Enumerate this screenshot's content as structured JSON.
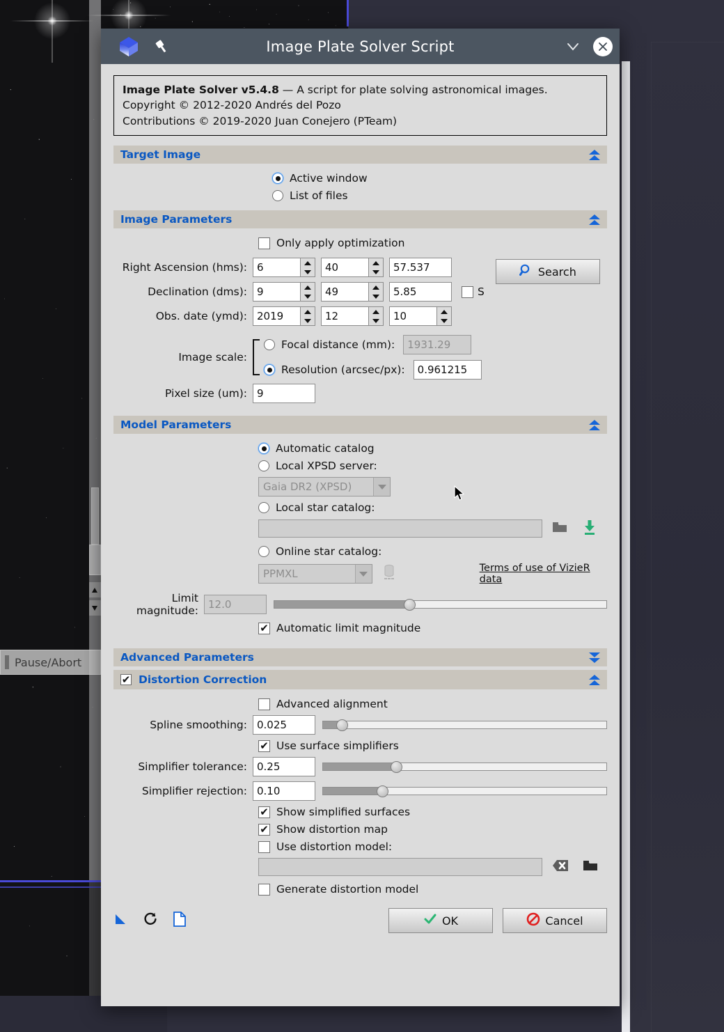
{
  "window": {
    "title": "Image Plate Solver Script",
    "icons": {
      "cube": "cube-icon",
      "pin": "pin-icon",
      "chevron": "chevron-down-icon",
      "close": "close-icon"
    }
  },
  "info": {
    "line1_bold": "Image Plate Solver v5.4.8",
    "line1_rest": " — A script for plate solving astronomical images.",
    "line2": "Copyright © 2012-2020 Andrés del Pozo",
    "line3": "Contributions © 2019-2020 Juan Conejero (PTeam)"
  },
  "sections": {
    "target_image": {
      "title": "Target Image",
      "options": [
        {
          "label": "Active window",
          "selected": true
        },
        {
          "label": "List of files",
          "selected": false
        }
      ]
    },
    "image_parameters": {
      "title": "Image Parameters",
      "only_apply_optimization": {
        "label": "Only apply optimization",
        "checked": false
      },
      "right_ascension": {
        "label": "Right Ascension (hms):",
        "h": "6",
        "m": "40",
        "s": "57.537"
      },
      "declination": {
        "label": "Declination (dms):",
        "d": "9",
        "m": "49",
        "s": "5.85",
        "south_label": "S",
        "south_checked": false
      },
      "obs_date": {
        "label": "Obs. date (ymd):",
        "y": "2019",
        "m": "12",
        "d": "10"
      },
      "search_button": "Search",
      "image_scale": {
        "label": "Image scale:",
        "focal_distance": {
          "label": "Focal distance (mm):",
          "value": "1931.29",
          "selected": false,
          "disabled": true
        },
        "resolution": {
          "label": "Resolution (arcsec/px):",
          "value": "0.961215",
          "selected": true,
          "disabled": false
        }
      },
      "pixel_size": {
        "label": "Pixel size (um):",
        "value": "9"
      }
    },
    "model_parameters": {
      "title": "Model Parameters",
      "automatic_catalog": {
        "label": "Automatic catalog",
        "selected": true
      },
      "local_xpsd_server": {
        "label": "Local XPSD server:",
        "selected": false,
        "combo_value": "Gaia DR2 (XPSD)"
      },
      "local_star_catalog": {
        "label": "Local star catalog:",
        "selected": false,
        "path_value": ""
      },
      "online_star_catalog": {
        "label": "Online star catalog:",
        "selected": false,
        "combo_value": "PPMXL"
      },
      "vizier_link": "Terms of use of VizieR data",
      "limit_magnitude": {
        "label": "Limit magnitude:",
        "value": "12.0",
        "disabled": true,
        "slider_pct": 40
      },
      "automatic_limit_magnitude": {
        "label": "Automatic limit magnitude",
        "checked": true
      }
    },
    "advanced_parameters": {
      "title": "Advanced Parameters",
      "collapsed": true
    },
    "distortion_correction": {
      "title": "Distortion Correction",
      "enabled": true,
      "advanced_alignment": {
        "label": "Advanced alignment",
        "checked": false
      },
      "spline_smoothing": {
        "label": "Spline smoothing:",
        "value": "0.025",
        "slider_pct": 6
      },
      "use_surface_simplifiers": {
        "label": "Use surface simplifiers",
        "checked": true
      },
      "simplifier_tolerance": {
        "label": "Simplifier tolerance:",
        "value": "0.25",
        "slider_pct": 25
      },
      "simplifier_rejection": {
        "label": "Simplifier rejection:",
        "value": "0.10",
        "slider_pct": 20
      },
      "show_simplified_surfaces": {
        "label": "Show simplified surfaces",
        "checked": true
      },
      "show_distortion_map": {
        "label": "Show distortion map",
        "checked": true
      },
      "use_distortion_model": {
        "label": "Use distortion model:",
        "checked": false,
        "path_value": ""
      },
      "generate_distortion_model": {
        "label": "Generate distortion model",
        "checked": false
      }
    }
  },
  "footer": {
    "icons": [
      "new-instance-icon",
      "reset-icon",
      "documentation-icon"
    ],
    "ok_label": "OK",
    "cancel_label": "Cancel"
  },
  "background": {
    "pause_abort_label": "Pause/Abort"
  },
  "colors": {
    "titlebar": "#4c5661",
    "dialog_bg": "#dcdcdc",
    "section_header_bg": "#c9c5bd",
    "section_header_text": "#0a58c2",
    "accent_blue": "#1565d8",
    "green": "#2bb673",
    "red": "#e02020",
    "desktop": "#2e2e3c"
  }
}
